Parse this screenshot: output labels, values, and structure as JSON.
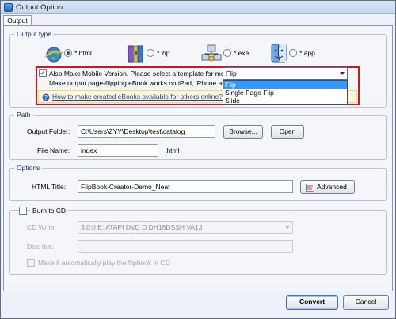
{
  "window": {
    "title": "Output Option",
    "tab_label": "Output"
  },
  "output_type": {
    "group_label": "Output type",
    "options": [
      {
        "icon": "globe-html-icon",
        "label": "*.html",
        "selected": true
      },
      {
        "icon": "zip-archive-icon",
        "label": "*.zip",
        "selected": false
      },
      {
        "icon": "network-exe-icon",
        "label": "*.exe",
        "selected": false
      },
      {
        "icon": "mac-finder-app-icon",
        "label": "*.app",
        "selected": false
      }
    ],
    "mobile_checkbox_label": "Also Make Mobile Version. Please select a template for mobile:",
    "mobile_checked": true,
    "mobile_hint": "Make output page-flipping eBook works on iPad, iPhone and Andr",
    "template_selected": "Flip",
    "template_options": [
      "Flip",
      "Single Page Flip",
      "Slide"
    ],
    "help_link": "How to make created eBooks available for others online?"
  },
  "path": {
    "group_label": "Path",
    "output_folder_label": "Output Folder:",
    "output_folder_value": "C:\\Users\\ZYY\\Desktop\\test\\catalog",
    "browse_label": "Browse...",
    "open_label": "Open",
    "file_name_label": "File Name:",
    "file_name_value": "index",
    "extension": ".html"
  },
  "options": {
    "group_label": "Options",
    "html_title_label": "HTML Title:",
    "html_title_value": "FlipBook-Creator-Demo_Neat",
    "advanced_label": "Advanced"
  },
  "burn": {
    "checkbox_label": "Burn to CD",
    "cd_writer_label": "CD Writer",
    "cd_writer_value": "3:0:0,E: ATAPI   DVD D  DH16DSSH  VA13",
    "disc_title_label": "Disc title:",
    "disc_title_value": "",
    "autoplay_label": "Make it automatically play the flipbook in CD"
  },
  "footer": {
    "convert_label": "Convert",
    "cancel_label": "Cancel"
  }
}
